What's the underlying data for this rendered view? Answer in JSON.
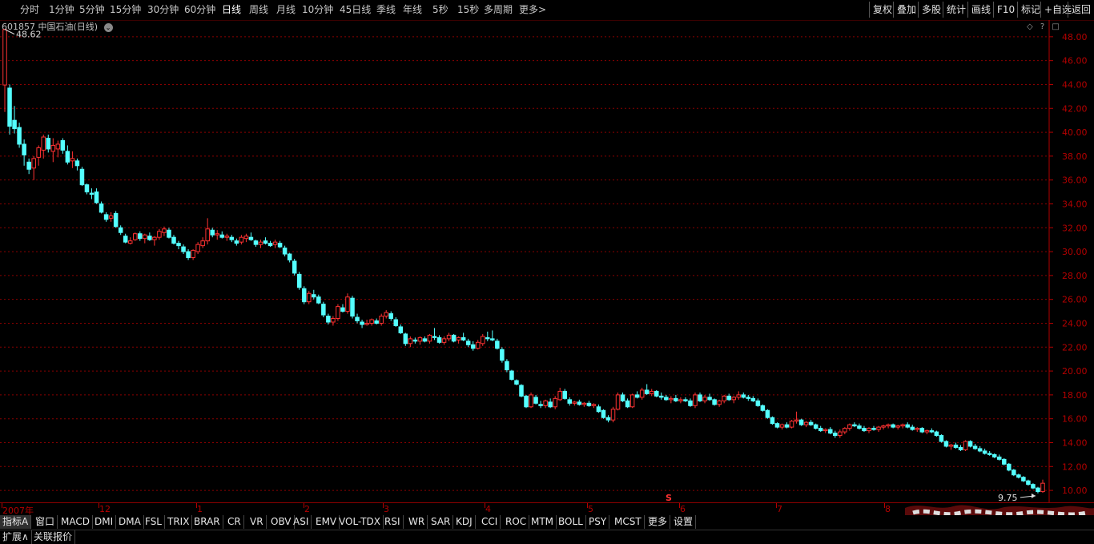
{
  "toolbar": {
    "periods": [
      "分时",
      "1分钟",
      "5分钟",
      "15分钟",
      "30分钟",
      "60分钟",
      "日线",
      "周线",
      "月线",
      "10分钟",
      "45日线",
      "季线",
      "年线",
      "5秒",
      "15秒",
      "多周期",
      "更多>"
    ],
    "active_period": "日线",
    "right_buttons": [
      "复权",
      "叠加",
      "多股",
      "统计",
      "画线",
      "F10",
      "标记",
      "+自选",
      "返回"
    ]
  },
  "stock": {
    "code": "601857",
    "name": "中国石油(日线)"
  },
  "chart_data": {
    "type": "candlestick",
    "title": "601857 中国石油(日线)",
    "y_ticks": [
      "48.00",
      "46.00",
      "44.00",
      "42.00",
      "40.00",
      "38.00",
      "36.00",
      "34.00",
      "32.00",
      "30.00",
      "28.00",
      "26.00",
      "24.00",
      "22.00",
      "20.00",
      "18.00",
      "16.00",
      "14.00",
      "12.00",
      "10.00"
    ],
    "ylim": [
      9.0,
      49.4
    ],
    "grid": true,
    "high_label": "48.62",
    "low_label": "9.75",
    "time_labels": [
      "2007年",
      "12",
      "1",
      "2",
      "3",
      "4",
      "5",
      "6",
      "7",
      "8"
    ],
    "event_marker": "S",
    "colors": {
      "up": "#ff3232",
      "down": "#54ffff",
      "grid": "#8b0000",
      "axis": "#b40000"
    },
    "candles": [
      [
        43.96,
        48.62,
        41.7,
        48.6
      ],
      [
        43.7,
        44.0,
        39.8,
        40.5
      ],
      [
        41.0,
        42.2,
        39.9,
        40.3
      ],
      [
        40.4,
        40.8,
        38.7,
        39.0
      ],
      [
        39.0,
        39.4,
        37.2,
        38.1
      ],
      [
        37.5,
        37.8,
        36.5,
        36.9
      ],
      [
        37.0,
        38.0,
        36.0,
        37.8
      ],
      [
        37.9,
        38.9,
        37.2,
        38.7
      ],
      [
        38.5,
        39.8,
        37.8,
        39.6
      ],
      [
        39.5,
        39.8,
        38.3,
        38.6
      ],
      [
        38.4,
        39.5,
        37.5,
        38.9
      ],
      [
        38.6,
        39.3,
        37.9,
        39.0
      ],
      [
        39.3,
        39.5,
        38.2,
        38.5
      ],
      [
        38.4,
        38.9,
        37.3,
        37.5
      ],
      [
        37.6,
        38.4,
        37.0,
        37.8
      ],
      [
        37.6,
        37.8,
        36.8,
        37.2
      ],
      [
        36.9,
        37.1,
        35.5,
        35.6
      ],
      [
        35.6,
        35.7,
        34.8,
        35.0
      ],
      [
        34.9,
        35.3,
        34.4,
        34.8
      ],
      [
        35.0,
        35.3,
        34.0,
        34.1
      ],
      [
        34.0,
        34.2,
        33.2,
        33.3
      ],
      [
        33.1,
        33.3,
        32.5,
        32.7
      ],
      [
        32.8,
        33.3,
        32.5,
        33.0
      ],
      [
        33.2,
        33.4,
        32.0,
        32.1
      ],
      [
        32.0,
        32.2,
        31.4,
        31.6
      ],
      [
        31.3,
        31.5,
        30.7,
        30.8
      ],
      [
        30.7,
        31.2,
        30.6,
        30.9
      ],
      [
        31.0,
        31.6,
        30.9,
        31.5
      ],
      [
        31.5,
        31.7,
        30.9,
        31.1
      ],
      [
        31.1,
        31.5,
        30.7,
        31.4
      ],
      [
        31.3,
        31.6,
        30.9,
        31.0
      ],
      [
        31.0,
        31.3,
        30.5,
        31.2
      ],
      [
        31.2,
        31.9,
        31.0,
        31.7
      ],
      [
        31.6,
        32.1,
        31.3,
        31.9
      ],
      [
        31.8,
        32.0,
        31.1,
        31.2
      ],
      [
        31.2,
        31.4,
        30.6,
        30.7
      ],
      [
        30.7,
        30.9,
        30.2,
        30.5
      ],
      [
        30.4,
        30.6,
        29.8,
        30.0
      ],
      [
        30.0,
        30.2,
        29.3,
        29.5
      ],
      [
        29.5,
        30.2,
        29.3,
        30.1
      ],
      [
        30.0,
        30.8,
        29.8,
        30.6
      ],
      [
        30.5,
        31.2,
        30.3,
        30.9
      ],
      [
        30.9,
        32.8,
        30.6,
        31.9
      ],
      [
        31.8,
        32.0,
        31.2,
        31.4
      ],
      [
        31.4,
        31.8,
        31.0,
        31.5
      ],
      [
        31.4,
        31.7,
        31.1,
        31.2
      ],
      [
        31.2,
        31.5,
        30.9,
        31.3
      ],
      [
        31.2,
        31.4,
        30.8,
        31.0
      ],
      [
        30.9,
        31.1,
        30.5,
        30.7
      ],
      [
        30.8,
        31.4,
        30.6,
        31.2
      ],
      [
        31.1,
        31.5,
        30.8,
        31.3
      ],
      [
        31.2,
        31.6,
        30.9,
        31.0
      ],
      [
        30.9,
        31.0,
        30.4,
        30.6
      ],
      [
        30.6,
        31.0,
        30.3,
        30.8
      ],
      [
        30.9,
        31.2,
        30.6,
        30.7
      ],
      [
        30.7,
        30.9,
        30.4,
        30.5
      ],
      [
        30.6,
        31.0,
        30.3,
        30.8
      ],
      [
        30.7,
        30.9,
        30.3,
        30.4
      ],
      [
        30.3,
        30.5,
        29.6,
        29.8
      ],
      [
        29.8,
        29.9,
        29.1,
        29.3
      ],
      [
        29.2,
        29.4,
        28.0,
        28.2
      ],
      [
        28.1,
        28.3,
        26.8,
        27.0
      ],
      [
        26.9,
        27.1,
        25.6,
        25.8
      ],
      [
        25.8,
        26.7,
        25.6,
        26.5
      ],
      [
        26.4,
        26.8,
        26.0,
        26.2
      ],
      [
        26.2,
        26.4,
        25.6,
        25.7
      ],
      [
        25.6,
        25.8,
        24.5,
        24.7
      ],
      [
        24.6,
        24.8,
        23.9,
        24.1
      ],
      [
        24.1,
        24.6,
        23.8,
        24.4
      ],
      [
        24.4,
        25.6,
        24.2,
        25.4
      ],
      [
        25.3,
        25.6,
        24.9,
        25.0
      ],
      [
        25.0,
        26.5,
        24.8,
        26.2
      ],
      [
        26.1,
        26.3,
        24.4,
        24.6
      ],
      [
        24.5,
        24.8,
        24.0,
        24.2
      ],
      [
        24.1,
        24.3,
        23.6,
        23.9
      ],
      [
        23.9,
        24.3,
        23.8,
        24.0
      ],
      [
        24.0,
        24.4,
        23.8,
        24.3
      ],
      [
        24.2,
        24.4,
        23.9,
        24.0
      ],
      [
        24.0,
        24.8,
        23.8,
        24.6
      ],
      [
        24.6,
        25.1,
        24.4,
        24.9
      ],
      [
        24.8,
        25.0,
        24.2,
        24.4
      ],
      [
        24.3,
        24.5,
        23.7,
        23.8
      ],
      [
        23.7,
        23.9,
        23.1,
        23.2
      ],
      [
        23.1,
        23.2,
        22.1,
        22.3
      ],
      [
        22.3,
        22.9,
        22.0,
        22.7
      ],
      [
        22.6,
        22.8,
        22.3,
        22.5
      ],
      [
        22.5,
        22.9,
        22.2,
        22.8
      ],
      [
        22.7,
        22.9,
        22.4,
        22.5
      ],
      [
        22.5,
        23.1,
        22.3,
        23.0
      ],
      [
        22.9,
        23.6,
        22.6,
        22.8
      ],
      [
        22.8,
        23.0,
        22.3,
        22.4
      ],
      [
        22.4,
        22.9,
        22.2,
        22.7
      ],
      [
        22.7,
        23.2,
        22.5,
        23.0
      ],
      [
        23.0,
        23.1,
        22.4,
        22.5
      ],
      [
        22.6,
        22.9,
        22.3,
        22.8
      ],
      [
        22.8,
        23.2,
        22.5,
        22.6
      ],
      [
        22.5,
        22.7,
        22.0,
        22.2
      ],
      [
        22.2,
        22.5,
        21.7,
        21.9
      ],
      [
        21.9,
        22.6,
        21.8,
        22.4
      ],
      [
        22.3,
        23.1,
        22.1,
        22.9
      ],
      [
        22.8,
        23.3,
        22.5,
        22.7
      ],
      [
        22.7,
        23.4,
        22.5,
        22.6
      ],
      [
        22.5,
        22.7,
        21.8,
        21.9
      ],
      [
        21.8,
        22.0,
        20.7,
        20.9
      ],
      [
        20.8,
        21.0,
        19.9,
        20.1
      ],
      [
        20.0,
        20.1,
        19.2,
        19.3
      ],
      [
        19.2,
        19.3,
        18.8,
        18.9
      ],
      [
        18.8,
        18.9,
        17.8,
        17.9
      ],
      [
        17.9,
        18.0,
        16.9,
        17.0
      ],
      [
        17.0,
        18.2,
        16.9,
        18.0
      ],
      [
        17.8,
        18.0,
        17.2,
        17.3
      ],
      [
        17.2,
        17.5,
        16.9,
        17.1
      ],
      [
        17.1,
        17.6,
        16.9,
        17.5
      ],
      [
        17.4,
        17.7,
        16.9,
        17.0
      ],
      [
        17.0,
        17.9,
        16.8,
        17.7
      ],
      [
        17.6,
        18.6,
        17.5,
        18.3
      ],
      [
        18.3,
        18.5,
        17.6,
        17.7
      ],
      [
        17.6,
        17.8,
        17.1,
        17.3
      ],
      [
        17.3,
        17.5,
        17.1,
        17.4
      ],
      [
        17.4,
        17.6,
        17.1,
        17.2
      ],
      [
        17.2,
        17.4,
        17.0,
        17.3
      ],
      [
        17.3,
        17.5,
        17.0,
        17.1
      ],
      [
        17.1,
        17.3,
        16.9,
        17.2
      ],
      [
        17.0,
        17.2,
        16.5,
        16.6
      ],
      [
        16.7,
        16.8,
        16.0,
        16.1
      ],
      [
        16.1,
        16.3,
        15.7,
        15.9
      ],
      [
        15.9,
        17.0,
        15.7,
        16.8
      ],
      [
        16.8,
        18.2,
        16.7,
        18.0
      ],
      [
        18.0,
        18.2,
        17.4,
        17.5
      ],
      [
        17.5,
        17.7,
        16.9,
        17.0
      ],
      [
        17.0,
        18.1,
        16.9,
        18.0
      ],
      [
        18.0,
        18.3,
        17.7,
        17.8
      ],
      [
        17.8,
        18.6,
        17.6,
        18.4
      ],
      [
        18.4,
        18.9,
        18.0,
        18.1
      ],
      [
        18.1,
        18.5,
        17.9,
        18.3
      ],
      [
        18.3,
        18.4,
        17.8,
        17.9
      ],
      [
        17.9,
        18.2,
        17.6,
        17.8
      ],
      [
        17.8,
        18.0,
        17.5,
        17.6
      ],
      [
        17.6,
        17.9,
        17.3,
        17.7
      ],
      [
        17.7,
        18.0,
        17.4,
        17.5
      ],
      [
        17.5,
        17.8,
        17.3,
        17.6
      ],
      [
        17.6,
        17.8,
        17.4,
        17.5
      ],
      [
        17.5,
        17.7,
        17.0,
        17.1
      ],
      [
        17.1,
        18.2,
        16.9,
        18.0
      ],
      [
        18.0,
        18.2,
        17.4,
        17.5
      ],
      [
        17.5,
        18.0,
        17.3,
        17.8
      ],
      [
        17.8,
        18.1,
        17.5,
        17.6
      ],
      [
        17.6,
        17.7,
        17.1,
        17.2
      ],
      [
        17.2,
        17.6,
        17.0,
        17.5
      ],
      [
        17.5,
        18.0,
        17.3,
        17.9
      ],
      [
        17.9,
        18.1,
        17.5,
        17.6
      ],
      [
        17.6,
        17.9,
        17.3,
        17.8
      ],
      [
        17.8,
        18.3,
        17.6,
        18.0
      ],
      [
        18.0,
        18.2,
        17.7,
        17.8
      ],
      [
        17.8,
        18.0,
        17.5,
        17.7
      ],
      [
        17.7,
        17.9,
        17.4,
        17.5
      ],
      [
        17.5,
        17.7,
        17.0,
        17.1
      ],
      [
        17.1,
        17.2,
        16.6,
        16.7
      ],
      [
        16.7,
        16.8,
        16.0,
        16.1
      ],
      [
        16.1,
        16.2,
        15.5,
        15.6
      ],
      [
        15.6,
        15.7,
        15.2,
        15.3
      ],
      [
        15.3,
        15.6,
        15.1,
        15.5
      ],
      [
        15.5,
        15.7,
        15.2,
        15.3
      ],
      [
        15.3,
        15.9,
        15.2,
        15.8
      ],
      [
        15.8,
        16.6,
        15.6,
        15.9
      ],
      [
        15.9,
        16.0,
        15.4,
        15.5
      ],
      [
        15.5,
        15.8,
        15.3,
        15.7
      ],
      [
        15.7,
        15.9,
        15.4,
        15.5
      ],
      [
        15.5,
        15.6,
        15.1,
        15.2
      ],
      [
        15.2,
        15.4,
        14.9,
        15.0
      ],
      [
        15.0,
        15.2,
        14.8,
        15.1
      ],
      [
        15.1,
        15.3,
        14.7,
        14.8
      ],
      [
        14.8,
        15.0,
        14.4,
        14.6
      ],
      [
        14.6,
        15.1,
        14.4,
        14.9
      ],
      [
        14.9,
        15.3,
        14.7,
        15.2
      ],
      [
        15.2,
        15.6,
        15.0,
        15.5
      ],
      [
        15.5,
        15.7,
        15.3,
        15.4
      ],
      [
        15.4,
        15.6,
        15.1,
        15.2
      ],
      [
        15.2,
        15.4,
        14.9,
        15.0
      ],
      [
        15.0,
        15.3,
        14.8,
        15.2
      ],
      [
        15.2,
        15.4,
        15.0,
        15.1
      ],
      [
        15.1,
        15.4,
        14.9,
        15.3
      ],
      [
        15.3,
        15.5,
        15.1,
        15.4
      ],
      [
        15.4,
        15.6,
        15.2,
        15.5
      ],
      [
        15.5,
        15.6,
        15.2,
        15.3
      ],
      [
        15.3,
        15.5,
        15.1,
        15.4
      ],
      [
        15.4,
        15.6,
        15.2,
        15.5
      ],
      [
        15.5,
        15.7,
        15.2,
        15.3
      ],
      [
        15.3,
        15.5,
        15.0,
        15.1
      ],
      [
        15.1,
        15.3,
        14.9,
        15.2
      ],
      [
        15.2,
        15.3,
        14.8,
        14.9
      ],
      [
        14.9,
        15.1,
        14.7,
        15.0
      ],
      [
        15.0,
        15.2,
        14.8,
        14.9
      ],
      [
        14.9,
        15.0,
        14.5,
        14.6
      ],
      [
        14.6,
        14.7,
        14.0,
        14.1
      ],
      [
        14.1,
        14.2,
        13.6,
        13.7
      ],
      [
        13.7,
        13.9,
        13.4,
        13.8
      ],
      [
        13.8,
        14.0,
        13.5,
        13.6
      ],
      [
        13.6,
        13.8,
        13.3,
        13.4
      ],
      [
        13.4,
        14.2,
        13.3,
        14.1
      ],
      [
        14.1,
        14.2,
        13.6,
        13.7
      ],
      [
        13.7,
        13.9,
        13.4,
        13.5
      ],
      [
        13.5,
        13.7,
        13.2,
        13.3
      ],
      [
        13.3,
        13.5,
        13.0,
        13.1
      ],
      [
        13.1,
        13.3,
        12.9,
        13.0
      ],
      [
        13.0,
        13.1,
        12.7,
        12.8
      ],
      [
        12.8,
        13.0,
        12.5,
        12.6
      ],
      [
        12.6,
        12.7,
        12.1,
        12.2
      ],
      [
        12.2,
        12.3,
        11.6,
        11.7
      ],
      [
        11.7,
        11.8,
        11.2,
        11.3
      ],
      [
        11.3,
        11.4,
        11.0,
        11.1
      ],
      [
        11.1,
        11.2,
        10.7,
        10.8
      ],
      [
        10.8,
        10.9,
        10.4,
        10.5
      ],
      [
        10.5,
        10.6,
        10.1,
        10.2
      ],
      [
        10.2,
        10.3,
        9.75,
        9.9
      ],
      [
        9.9,
        10.9,
        9.8,
        10.6
      ]
    ]
  },
  "indicators": [
    "指标A",
    "窗口",
    "MACD",
    "DMI",
    "DMA",
    "FSL",
    "TRIX",
    "BRAR",
    "CR",
    "VR",
    "OBV",
    "ASI",
    "EMV",
    "VOL-TDX",
    "RSI",
    "WR",
    "SAR",
    "KDJ",
    "CCI",
    "ROC",
    "MTM",
    "BOLL",
    "PSY",
    "MCST",
    "更多",
    "设置"
  ],
  "bottom_tabs": [
    "扩展∧",
    "关联报价"
  ]
}
